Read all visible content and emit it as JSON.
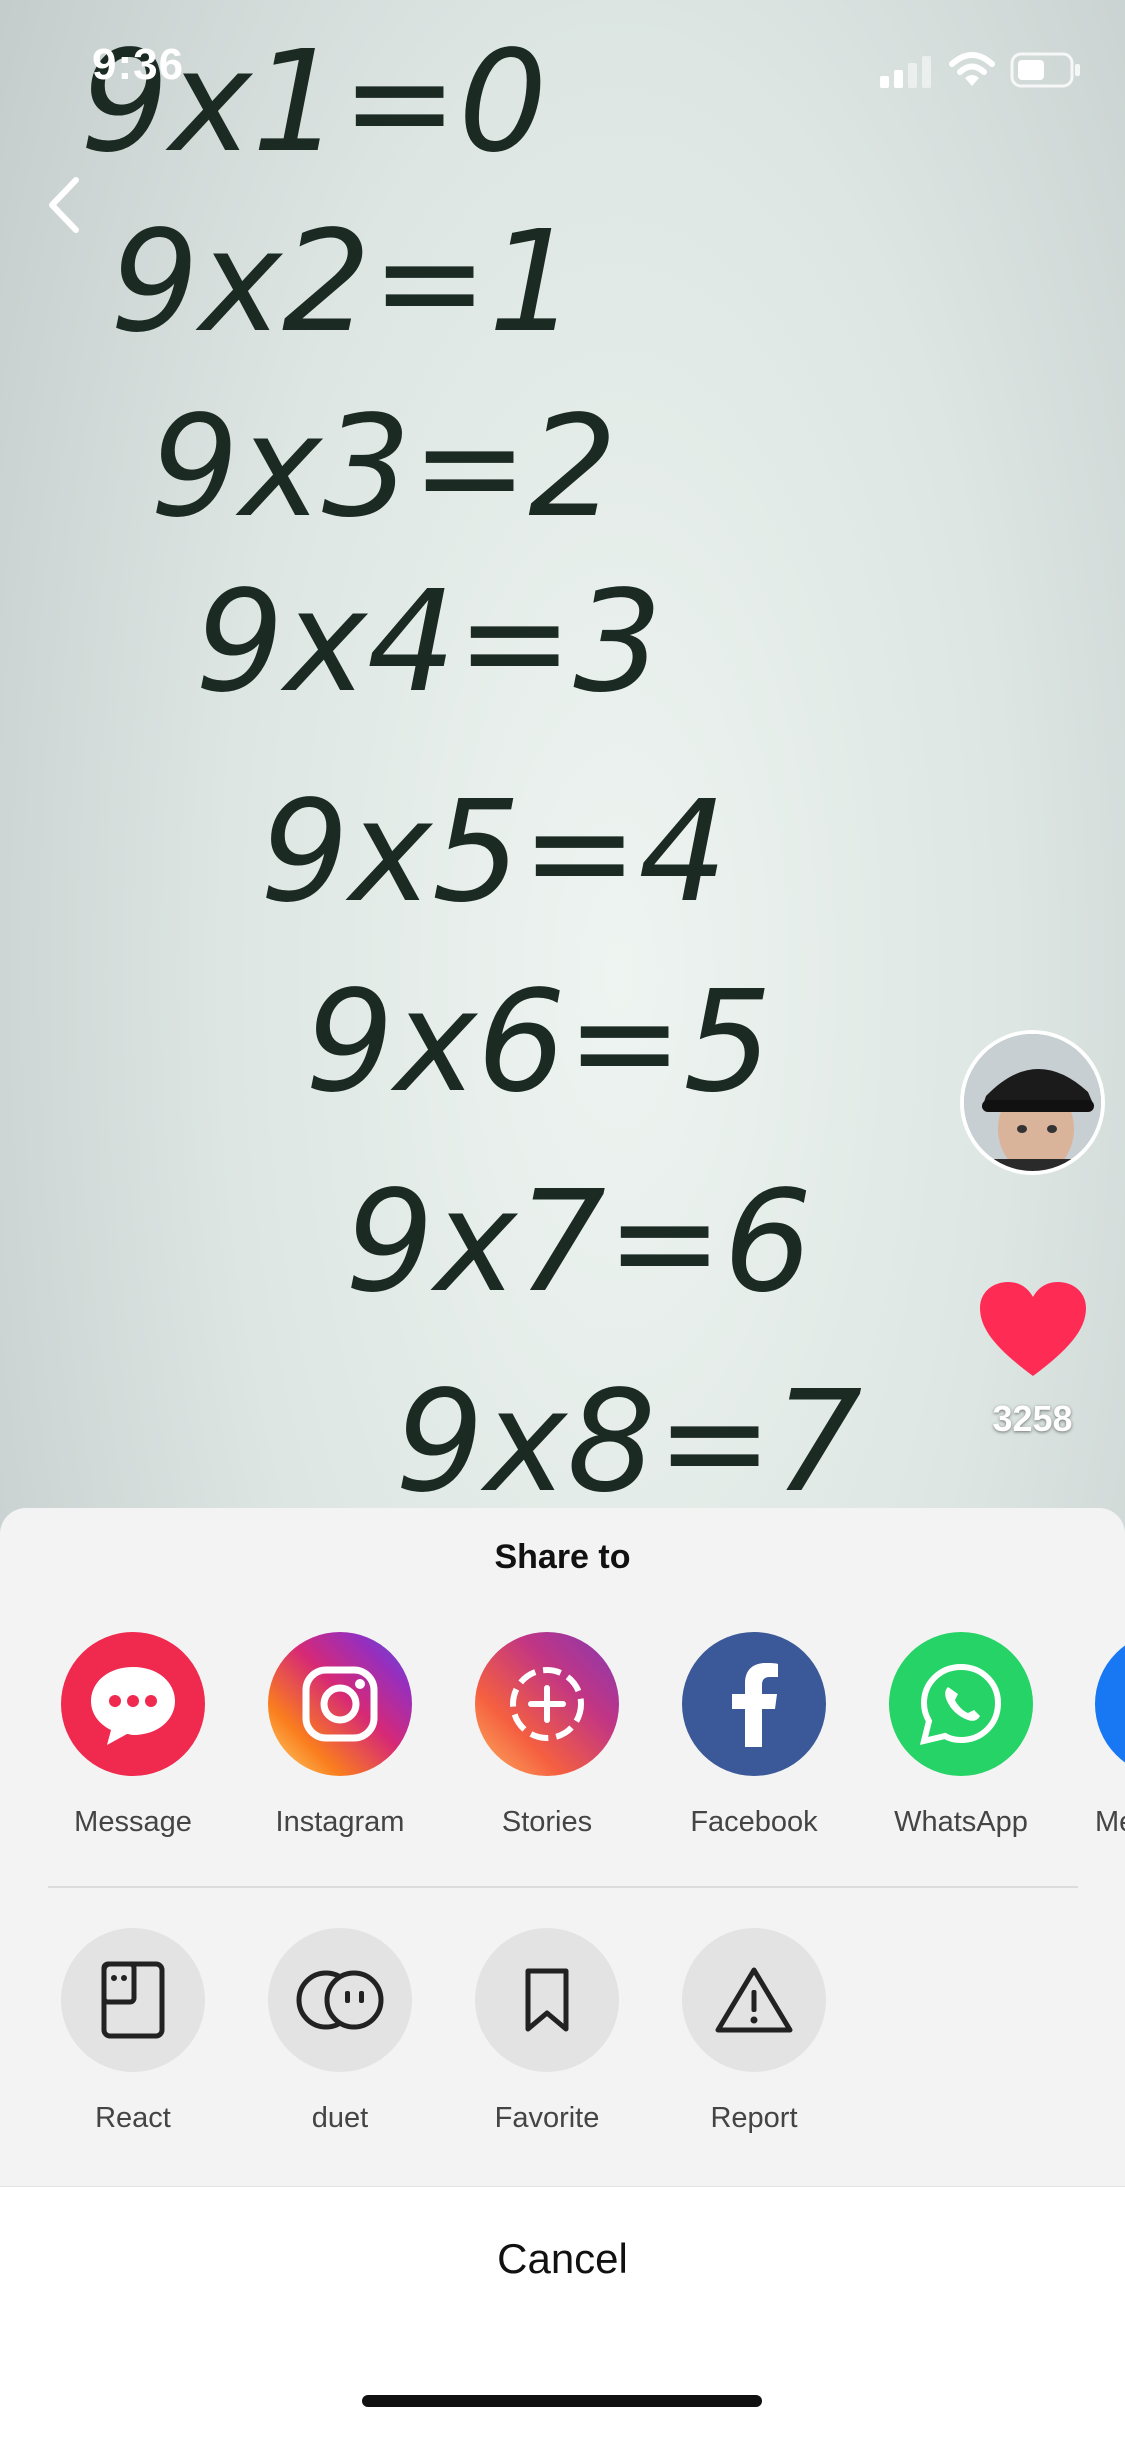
{
  "status_bar": {
    "time": "9:36"
  },
  "video": {
    "handwriting_lines": [
      "9x1=0",
      "9x2=1",
      "9x3=2",
      "9x4=3",
      "9x5=4",
      "9x6=5",
      "9x7=6",
      "9x8=7"
    ]
  },
  "side_actions": {
    "likes": "3258"
  },
  "share_sheet": {
    "title": "Share to",
    "apps": [
      {
        "label": "Message",
        "color": "#f0294f",
        "icon": "chat-bubble-icon"
      },
      {
        "label": "Instagram",
        "color": "#d6249f",
        "icon": "instagram-icon"
      },
      {
        "label": "Stories",
        "color": "#b83bb3",
        "icon": "stories-icon"
      },
      {
        "label": "Facebook",
        "color": "#3b5998",
        "icon": "facebook-icon"
      },
      {
        "label": "WhatsApp",
        "color": "#25d366",
        "icon": "whatsapp-icon"
      },
      {
        "label": "Me",
        "color": "#1877f2",
        "icon": "messenger-icon"
      }
    ],
    "actions": [
      {
        "label": "React",
        "icon": "react-icon"
      },
      {
        "label": "duet",
        "icon": "duet-icon"
      },
      {
        "label": "Favorite",
        "icon": "bookmark-icon"
      },
      {
        "label": "Report",
        "icon": "warning-icon"
      }
    ],
    "cancel": "Cancel"
  }
}
